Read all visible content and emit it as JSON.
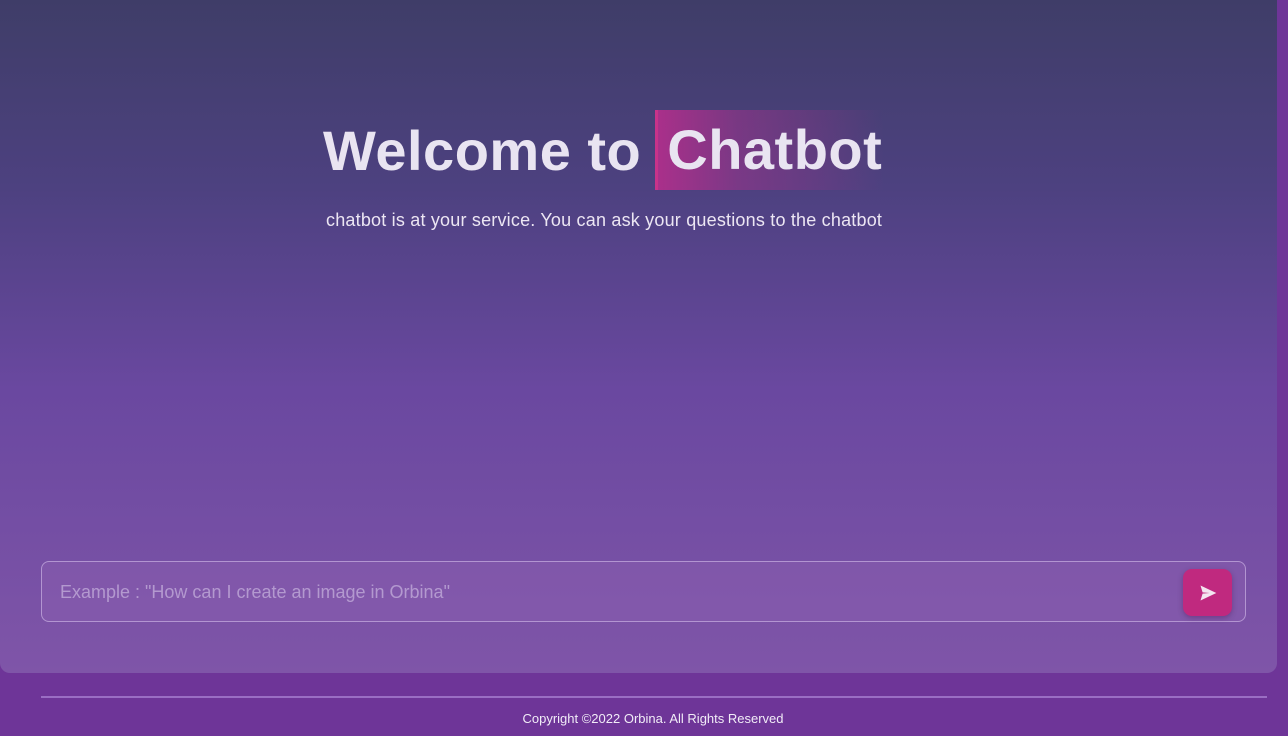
{
  "hero": {
    "title_prefix": "Welcome to",
    "title_highlight": "Chatbot",
    "subtitle": "chatbot is at your service. You can ask your questions to the chatbot"
  },
  "chat_input": {
    "value": "",
    "placeholder": "Example : \"How can I create an image in Orbina\""
  },
  "send": {
    "icon": "send-icon"
  },
  "footer": {
    "copyright": "Copyright ©2022 Orbina. All Rights Reserved"
  },
  "colors": {
    "accent": "#c0297f",
    "background": "#6e3598",
    "panel_top": "#3f3d68",
    "panel_bottom": "#7f55a8"
  }
}
